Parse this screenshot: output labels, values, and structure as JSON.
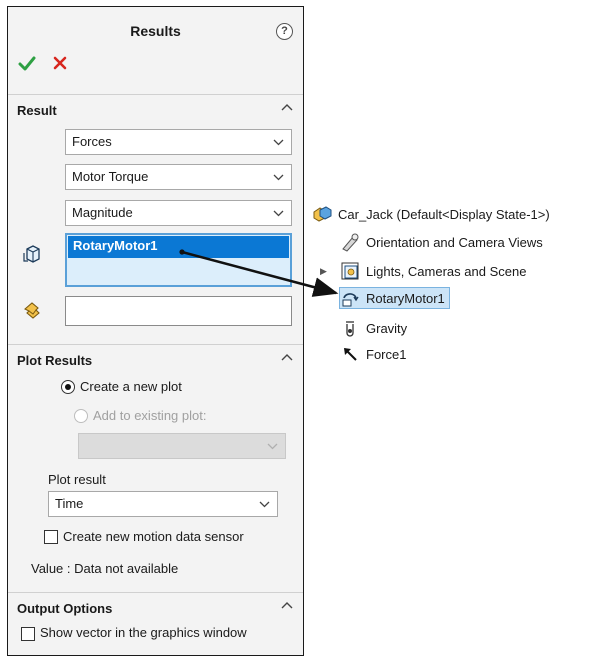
{
  "panel": {
    "title": "Results",
    "help_icon": "?"
  },
  "result_section": {
    "label": "Result",
    "category_select": "Forces",
    "subcategory_select": "Motor Torque",
    "component_select": "Magnitude",
    "selected_item": "RotaryMotor1"
  },
  "plot_results": {
    "label": "Plot Results",
    "create_new_plot": "Create a new plot",
    "add_existing": "Add to existing plot:",
    "plot_result_label": "Plot result",
    "plot_result_value": "Time",
    "create_sensor": "Create new motion data sensor",
    "value_text": "Value : Data not available"
  },
  "output_options": {
    "label": "Output Options",
    "show_vector": "Show vector in the graphics window"
  },
  "tree": {
    "root": "Car_Jack  (Default<Display State-1>)",
    "items": [
      {
        "label": "Orientation and Camera Views",
        "icon": "camera-icon"
      },
      {
        "label": "Lights, Cameras and Scene",
        "icon": "lights-icon"
      },
      {
        "label": "RotaryMotor1",
        "icon": "rotary-motor-icon"
      },
      {
        "label": "Gravity",
        "icon": "gravity-icon"
      },
      {
        "label": "Force1",
        "icon": "force-arrow-icon"
      }
    ]
  },
  "colors": {
    "accent": "#0b78d4",
    "ok_green": "#2ea043",
    "cancel_red": "#d7261e"
  }
}
